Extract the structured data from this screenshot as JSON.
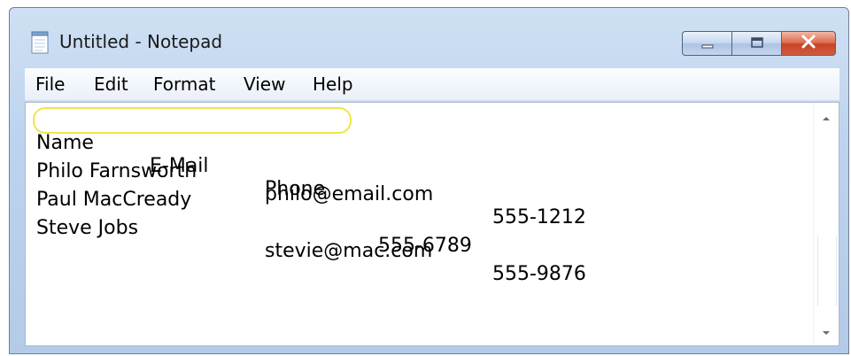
{
  "window": {
    "title": "Untitled - Notepad",
    "icons": {
      "app": "notepad-icon",
      "minimize": "minimize-icon",
      "maximize": "maximize-icon",
      "close": "close-icon"
    }
  },
  "menu": {
    "file": "File",
    "edit": "Edit",
    "format": "Format",
    "view": "View",
    "help": "Help"
  },
  "document": {
    "header": {
      "name": "Name",
      "email": "E-Mail",
      "phone": "Phone"
    },
    "rows": [
      {
        "name": "Philo Farnsworth",
        "email": "philo@email.com",
        "phone": "555-1212"
      },
      {
        "name": "Paul MacCready",
        "email": "",
        "phone": "555-6789"
      },
      {
        "name": "Steve Jobs",
        "email": "stevie@mac.com",
        "phone": "555-9876"
      }
    ],
    "highlight_color": "#f0e54a"
  },
  "colors": {
    "frame": "#bcd3ee",
    "close_button": "#c4432a"
  }
}
